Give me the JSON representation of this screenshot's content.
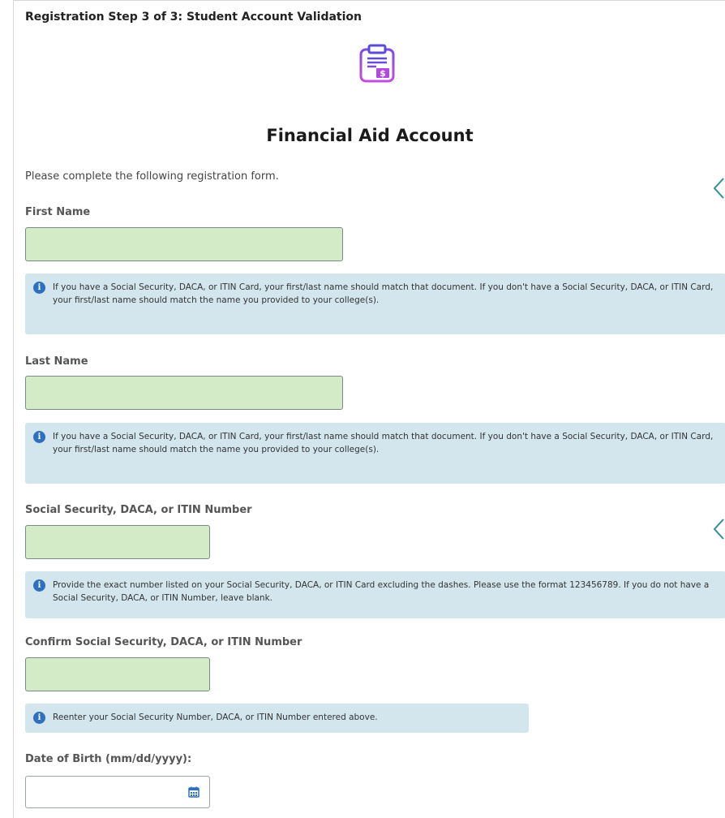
{
  "step_title": "Registration Step 3 of 3: Student Account Validation",
  "page_title": "Financial Aid Account",
  "header_icon": "clipboard-dollar-icon",
  "intro": "Please complete the following registration form.",
  "colors": {
    "input_bg": "#d4ebc8",
    "info_bg": "#d3e6ee",
    "info_icon": "#2f6fc0",
    "header_icon": "#a24be8",
    "calendar_icon": "#2f6fc0",
    "chevron": "#2f8f9e"
  },
  "fields": {
    "first_name": {
      "label": "First Name",
      "value": "",
      "info": "If you have a Social Security, DACA, or ITIN Card, your first/last name should match that document. If you don't have a Social Security, DACA, or ITIN Card, your first/last name should match the name you provided to your college(s)."
    },
    "last_name": {
      "label": "Last Name",
      "value": "",
      "info": "If you have a Social Security, DACA, or ITIN Card, your first/last name should match that document. If you don't have a Social Security, DACA, or ITIN Card, your first/last name should match the name you provided to your college(s)."
    },
    "ssn": {
      "label": "Social Security, DACA, or ITIN Number",
      "value": "",
      "info": "Provide the exact number listed on your Social Security, DACA, or ITIN Card excluding the dashes. Please use the format 123456789. If you do not have a Social Security, DACA, or ITIN Number, leave blank."
    },
    "confirm_ssn": {
      "label": "Confirm Social Security, DACA, or ITIN Number",
      "value": "",
      "info": "Reenter your Social Security Number, DACA, or ITIN Number entered above."
    },
    "dob": {
      "label": "Date of Birth (mm/dd/yyyy):",
      "value": ""
    }
  },
  "icons": {
    "info": "info-icon",
    "calendar": "calendar-icon",
    "chevron": "chevron-left-icon"
  }
}
